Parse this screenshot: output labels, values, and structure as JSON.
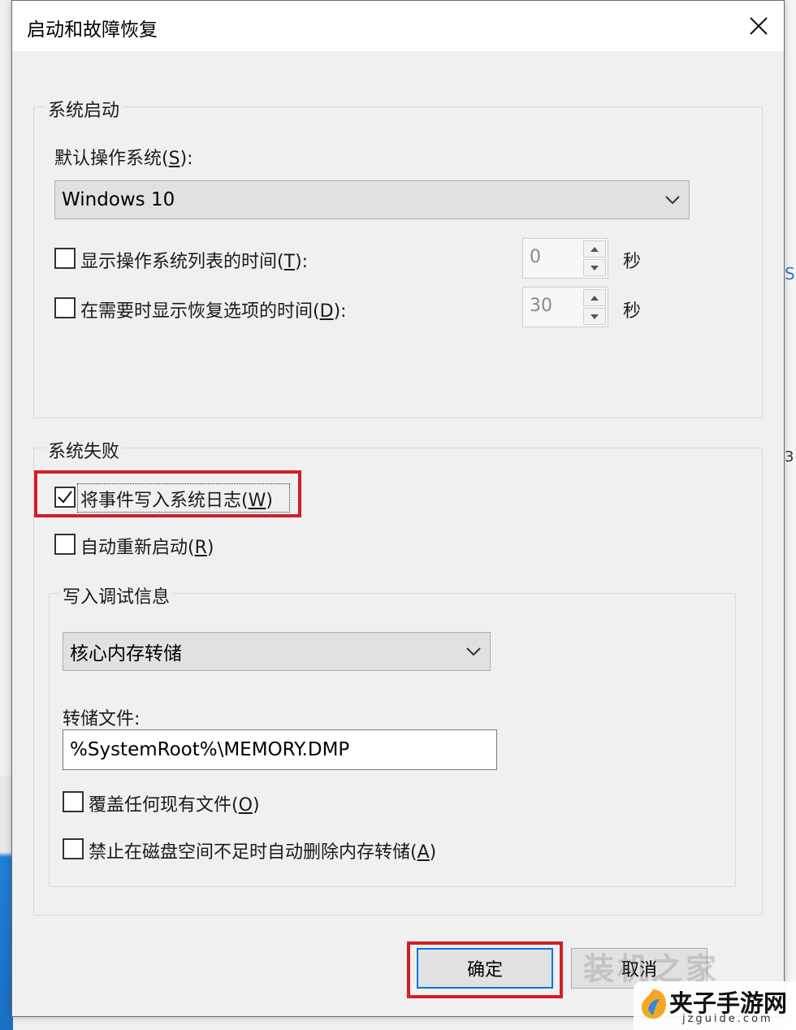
{
  "window": {
    "title": "启动和故障恢复"
  },
  "system_startup": {
    "group_label": "系统启动",
    "default_os_label": "默认操作系统",
    "default_os_key": "S",
    "default_os_value": "Windows 10",
    "show_os_list": {
      "label": "显示操作系统列表的时间",
      "key": "T",
      "checked": false,
      "value": "0",
      "unit": "秒"
    },
    "show_recovery": {
      "label": "在需要时显示恢复选项的时间",
      "key": "D",
      "checked": false,
      "value": "30",
      "unit": "秒"
    }
  },
  "system_failure": {
    "group_label": "系统失败",
    "write_event": {
      "label": "将事件写入系统日志",
      "key": "W",
      "checked": true
    },
    "auto_restart": {
      "label": "自动重新启动",
      "key": "R",
      "checked": false
    },
    "debug_info": {
      "group_label": "写入调试信息",
      "dump_type": "核心内存转储",
      "dump_file_label": "转储文件:",
      "dump_file_value": "%SystemRoot%\\MEMORY.DMP",
      "overwrite": {
        "label": "覆盖任何现有文件",
        "key": "O",
        "checked": false
      },
      "disable_auto_delete": {
        "label": "禁止在磁盘空间不足时自动删除内存转储",
        "key": "A",
        "checked": false
      }
    }
  },
  "buttons": {
    "ok": "确定",
    "cancel": "取消"
  },
  "watermark": {
    "text": "装机之家",
    "brand_name": "夹子手游网",
    "brand_url": "jzguide.com"
  },
  "colors": {
    "highlight": "#d21f26",
    "focus_blue": "#0078d7",
    "desktop_blue": "#1f7fd6"
  }
}
